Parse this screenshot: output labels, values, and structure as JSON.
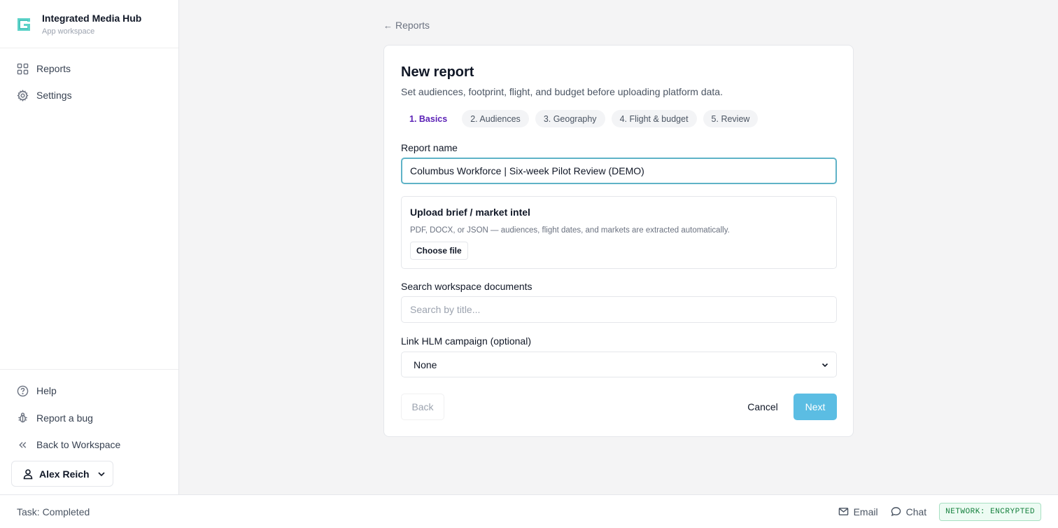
{
  "app": {
    "name": "Integrated Media Hub",
    "subtitle": "App workspace"
  },
  "sidebar": {
    "items": [
      {
        "label": "Reports",
        "icon": "grid-icon"
      },
      {
        "label": "Settings",
        "icon": "gear-icon"
      }
    ],
    "bottom_items": [
      {
        "label": "Help",
        "icon": "help-icon"
      },
      {
        "label": "Report a bug",
        "icon": "bug-icon"
      },
      {
        "label": "Back to Workspace",
        "icon": "double-chevron-left-icon"
      }
    ],
    "user": {
      "name": "Alex Reich"
    }
  },
  "breadcrumb": {
    "back_label": "Reports"
  },
  "form": {
    "title": "New report",
    "description": "Set audiences, footprint, flight, and budget before uploading platform data.",
    "steps": [
      "1. Basics",
      "2. Audiences",
      "3. Geography",
      "4. Flight & budget",
      "5. Review"
    ],
    "active_step": 0,
    "report_name": {
      "label": "Report name",
      "value": "Columbus Workforce | Six-week Pilot Review (DEMO)"
    },
    "upload": {
      "title": "Upload brief / market intel",
      "hint": "PDF, DOCX, or JSON — audiences, flight dates, and markets are extracted automatically.",
      "button": "Choose file"
    },
    "search": {
      "label": "Search workspace documents",
      "placeholder": "Search by title..."
    },
    "campaign": {
      "label": "Link HLM campaign (optional)",
      "selected": "None"
    },
    "buttons": {
      "back": "Back",
      "cancel": "Cancel",
      "next": "Next"
    }
  },
  "statusbar": {
    "task": "Task: Completed",
    "email": "Email",
    "chat": "Chat",
    "network": "NETWORK: ENCRYPTED"
  },
  "colors": {
    "accent": "#5bbde3",
    "focus_border": "#5fb3c7",
    "active_step": "#5b21b6",
    "brand_logo": "#5fd3c9",
    "network_badge": "#15803d"
  }
}
